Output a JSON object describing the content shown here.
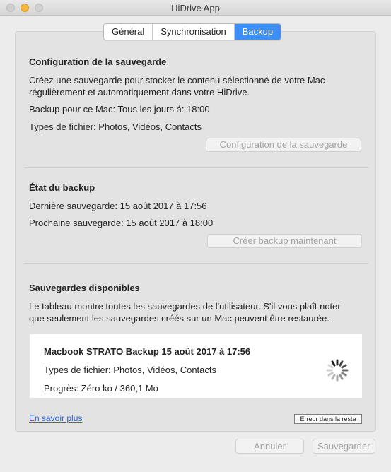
{
  "window": {
    "title": "HiDrive App"
  },
  "tabs": [
    {
      "label": "Général"
    },
    {
      "label": "Synchronisation"
    },
    {
      "label": "Backup"
    }
  ],
  "config": {
    "heading": "Configuration de la sauvegarde",
    "desc_line1": "Créez une sauvegarde pour stocker le contenu sélectionné de votre Mac",
    "desc_line2": "régulièrement et automatiquement dans votre HiDrive.",
    "schedule": "Backup pour ce Mac: Tous les jours á: 18:00",
    "filetypes": "Types de fichier: Photos, Vidéos, Contacts",
    "button": "Configuration de la sauvegarde"
  },
  "status": {
    "heading": "État du backup",
    "last": "Dernière sauvegarde: 15 août 2017 à 17:56",
    "next": "Prochaine sauvegarde: 15 août 2017 à 18:00",
    "button": "Créer backup maintenant"
  },
  "available": {
    "heading": "Sauvegardes disponibles",
    "desc_line1": "Le tableau montre toutes les sauvegardes de l'utilisateur. S'il vous plaît noter",
    "desc_line2": "que seulement les sauvegardes créés sur un Mac peuvent être restaurée.",
    "item": {
      "title": "Macbook STRATO Backup 15 août 2017 à 17:56",
      "filetypes": "Types de fichier: Photos, Vidéos, Contacts",
      "progress": "Progrès: Zéro ko / 360,1 Mo"
    }
  },
  "footer": {
    "learn_more": "En  savoir plus",
    "error_button": "Erreur dans la resta",
    "cancel": "Annuler",
    "save": "Sauvegarder"
  },
  "colors": {
    "accent": "#3d8ef6",
    "link": "#2b64d8",
    "minimize": "#f4b840"
  }
}
